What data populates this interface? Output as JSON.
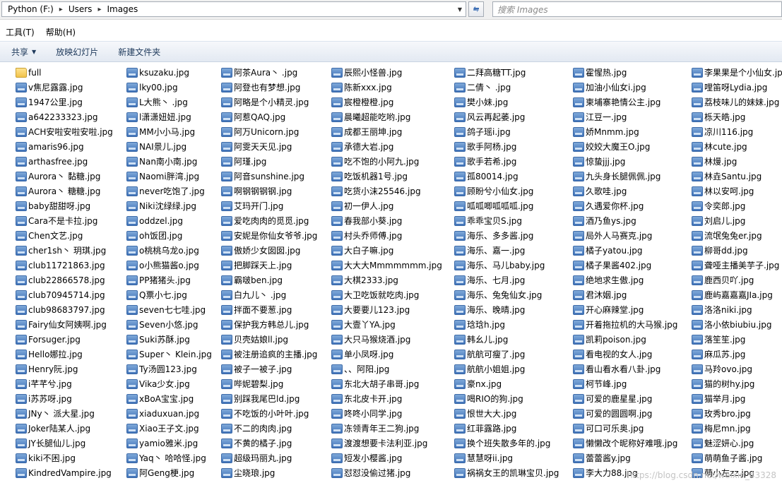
{
  "address": {
    "segments": [
      "Python (F:)",
      "Users",
      "Images"
    ]
  },
  "search": {
    "placeholder": "搜索 Images"
  },
  "menu": {
    "items": [
      "工具(T)",
      "帮助(H)"
    ]
  },
  "toolbar": {
    "share": "共享",
    "slideshow": "放映幻灯片",
    "new_folder": "新建文件夹"
  },
  "columns": [
    [
      "full",
      "v焦尼露露.jpg",
      "1947公里.jpg",
      "a642233323.jpg",
      "ACH安啦安啦安啦.jpg",
      "amaris96.jpg",
      "arthasfree.jpg",
      "Aurora丶 黏糖.jpg",
      "Aurora丶 糖糖.jpg",
      "baby甜甜呀.jpg",
      "Cara不是卡拉.jpg",
      "Chen文艺.jpg",
      "cher1sh丶 玥琪.jpg",
      "club11721863.jpg",
      "club22866578.jpg",
      "club70945714.jpg",
      "club98683797.jpg",
      "Fairy仙女阿姨啊.jpg",
      "Forsuger.jpg",
      "Hello娜拉.jpg",
      "Henry阮.jpg",
      "i芊芊兮.jpg",
      "i苏苏呀.jpg",
      "JNy丶 派大星.jpg",
      "Joker陆某人.jpg",
      "JY长腿仙儿.jpg",
      "kiki不困.jpg",
      "KindredVampire.jpg"
    ],
    [
      "ksuzaku.jpg",
      "lky00.jpg",
      "L大熊丶 .jpg",
      "l潇潇妞妞.jpg",
      "MM小小马.jpg",
      "NAI景儿.jpg",
      "Nan南小南.jpg",
      "Naomi胖湾.jpg",
      "never吃饱了.jpg",
      "Niki沈绿绿.jpg",
      "oddzel.jpg",
      "oh饭团.jpg",
      "o桃桃乌龙o.jpg",
      "o小熊猫酱o.jpg",
      "PP猪猪头.jpg",
      "Q票小七.jpg",
      "seven七七哇.jpg",
      "Seven小悠.jpg",
      "Suki苏酥.jpg",
      "Super丶 Klein.jpg",
      "Ty汤圆123.jpg",
      "Vika少女.jpg",
      "xBoA宝宝.jpg",
      "xiaduxuan.jpg",
      "Xiao王子文.jpg",
      "yamio雅米.jpg",
      "Yaq丶 哈哈怪.jpg",
      "阿Geng梗.jpg"
    ],
    [
      "阿茶Aura丶 .jpg",
      "阿登也有梦想.jpg",
      "阿略是个小精灵.jpg",
      "阿惹QAQ.jpg",
      "阿万Unicorn.jpg",
      "阿雯天天见.jpg",
      "阿瑾.jpg",
      "阿音sunshine.jpg",
      "啊钢钢钢钢.jpg",
      "艾玛开门.jpg",
      "爱吃肉肉的觅觅.jpg",
      "安妮是你仙女爷爷.jpg",
      "傲娇少女囡囡.jpg",
      "把脚踩天上.jpg",
      "霸啵ben.jpg",
      "白九儿丶 .jpg",
      "拌面不要葱.jpg",
      "保护我方韩总儿.jpg",
      "贝壳姑娘ll.jpg",
      "被注册追疯的主播.jpg",
      "被子一被子.jpg",
      "哔妮碧梨.jpg",
      "别踩我尾巴ld.jpg",
      "不吃饭的小叶叶.jpg",
      "不二的肉肉.jpg",
      "不黄的橘子.jpg",
      "超级玛丽丸.jpg",
      "尘晓琅.jpg"
    ],
    [
      "辰熙小怪兽.jpg",
      "陈新xxx.jpg",
      "宸橙橙橙.jpg",
      "晨曦超能吃哟.jpg",
      "成都王丽坤.jpg",
      "承德大岩.jpg",
      "吃不饱的小阿九.jpg",
      "吃饭机器1号.jpg",
      "吃货小沫25546.jpg",
      "初一伊人.jpg",
      "春我部小葵.jpg",
      "村头乔师傅.jpg",
      "大白子嘛.jpg",
      "大大大Mmmmmmm.jpg",
      "大棋2333.jpg",
      "大卫吃饭就吃肉.jpg",
      "大要要儿123.jpg",
      "大壹丫YA.jpg",
      "大只马猴烧酒.jpg",
      "单小凤呀.jpg",
      "、、阿阳.jpg",
      "东北大胡子串哥.jpg",
      "东北皮卡开.jpg",
      "咚咚小同学.jpg",
      "冻领青年王二狗.jpg",
      "渡渡想要卡法利亚.jpg",
      "短发小樱酱.jpg",
      "怼怼没偷过猪.jpg"
    ],
    [
      "二拜高糖TT.jpg",
      "二倩丶 .jpg",
      "樊小妹.jpg",
      "风云再起萎.jpg",
      "鸽子瑶i.jpg",
      "歌手阿杨.jpg",
      "歌手若希.jpg",
      "孤80014.jpg",
      "顾盼兮小仙女.jpg",
      "呱呱唧呱呱呱.jpg",
      "乖乖宝贝S.jpg",
      "海乐、多多酱.jpg",
      "海乐、嘉一.jpg",
      "海乐、马儿baby.jpg",
      "海乐、七月.jpg",
      "海乐、兔兔仙女.jpg",
      "海乐、晚晴.jpg",
      "琀琀h.jpg",
      "韩幺儿.jpg",
      "航航可瘦了.jpg",
      "航航小姐姐.jpg",
      "豪nx.jpg",
      "喝RIO的狗.jpg",
      "恨世大大.jpg",
      "红菲露路.jpg",
      "换个班失散多年的.jpg",
      "慧慧呀ii.jpg",
      "祸祸女王的凯琳宝贝.jpg"
    ],
    [
      "霍惺热.jpg",
      "加油小仙女i.jpg",
      "柬埔寨艳情公主.jpg",
      "江豆一.jpg",
      "娇Mnmm.jpg",
      "姣姣大魔王O.jpg",
      "惊蛰jjj.jpg",
      "九头身长腿佩佩.jpg",
      "久歌哇.jpg",
      "久遇爱你杯.jpg",
      "酒乃鱼ys.jpg",
      "局外人马赛克.jpg",
      "橘子yatou.jpg",
      "橘子果酱402.jpg",
      "绝地求生傲.jpg",
      "君沐姻.jpg",
      "开心麻辣堂.jpg",
      "开着拖拉机的大马猴.jpg",
      "凯莉poison.jpg",
      "看电视的女人.jpg",
      "看山看水看八卦.jpg",
      "柯节峰.jpg",
      "可爱的鹿星星.jpg",
      "可爱的圆圆啊.jpg",
      "可口可乐奥.jpg",
      "懒懒改个昵称好难哦.jpg",
      "蕾蕾酱y.jpg",
      "李大力88.jpg"
    ],
    [
      "李果果是个小仙女.jpg",
      "哩笛呀Lydia.jpg",
      "荔枝味儿的妹妹.jpg",
      "栎天皓.jpg",
      "凉川116.jpg",
      "林cute.jpg",
      "林熳.jpg",
      "林垚Santu.jpg",
      "林以安呵.jpg",
      "令奕郎.jpg",
      "刘启儿.jpg",
      "流氓兔兔er.jpg",
      "柳哥dd.jpg",
      "聋哑主播美芋子.jpg",
      "鹿西贝吖.jpg",
      "鹿屿嘉嘉嘉JIa.jpg",
      "洛洛niki.jpg",
      "洛小依biubiu.jpg",
      "落笙笙.jpg",
      "麻瓜苏.jpg",
      "马羚ovo.jpg",
      "猫的树hy.jpg",
      "猫举月.jpg",
      "玫秀bro.jpg",
      "梅尼mn.jpg",
      "魅涩妍心.jpg",
      "萌萌鱼子酱.jpg",
      "萌小左zz.jpg"
    ]
  ],
  "watermark": "https://blog.csdn.net/weixin_43328"
}
